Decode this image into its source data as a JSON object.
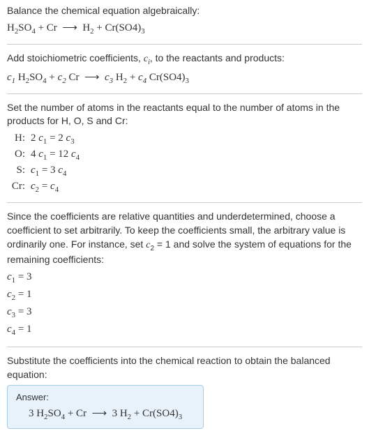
{
  "chart_data": {
    "type": "table",
    "equation": "3 H2SO4 + Cr → 3 H2 + Cr(SO4)3",
    "coefficients": {
      "c1": 3,
      "c2": 1,
      "c3": 3,
      "c4": 1
    },
    "atom_balance": {
      "H": "2 c1 = 2 c3",
      "O": "4 c1 = 12 c4",
      "S": "c1 = 3 c4",
      "Cr": "c2 = c4"
    }
  },
  "sec1": {
    "title": "Balance the chemical equation algebraically:"
  },
  "sec2": {
    "title": "Add stoichiometric coefficients, cᵢ, to the reactants and products:"
  },
  "sec3": {
    "title": "Set the number of atoms in the reactants equal to the number of atoms in the products for H, O, S and Cr:",
    "rows": [
      {
        "label": "H:",
        "eq": "2 c₁ = 2 c₃"
      },
      {
        "label": "O:",
        "eq": "4 c₁ = 12 c₄"
      },
      {
        "label": "S:",
        "eq": "c₁ = 3 c₄"
      },
      {
        "label": "Cr:",
        "eq": "c₂ = c₄"
      }
    ]
  },
  "sec4": {
    "title": "Since the coefficients are relative quantities and underdetermined, choose a coefficient to set arbitrarily. To keep the coefficients small, the arbitrary value is ordinarily one. For instance, set c₂ = 1 and solve the system of equations for the remaining coefficients:",
    "rows": [
      "c₁ = 3",
      "c₂ = 1",
      "c₃ = 3",
      "c₄ = 1"
    ]
  },
  "sec5": {
    "title": "Substitute the coefficients into the chemical reaction to obtain the balanced equation:"
  },
  "answer": {
    "label": "Answer:"
  }
}
